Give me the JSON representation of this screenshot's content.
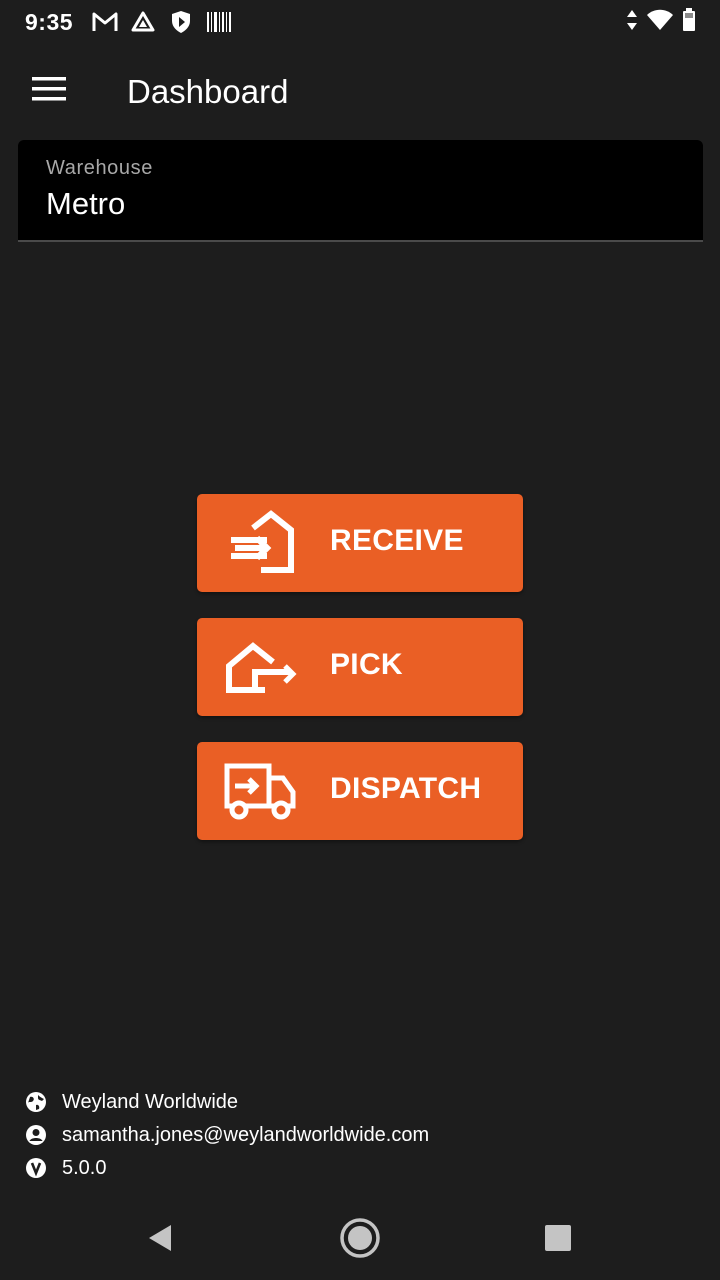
{
  "status_bar": {
    "time": "9:35",
    "left_icons": [
      "gmail-icon",
      "drive-icon",
      "shield-play-icon",
      "barcode-icon"
    ],
    "right_icons": [
      "data-arrows-icon",
      "wifi-icon",
      "battery-icon"
    ]
  },
  "app_bar": {
    "title": "Dashboard",
    "menu_icon": "hamburger-menu-icon"
  },
  "warehouse": {
    "label": "Warehouse",
    "value": "Metro"
  },
  "actions": {
    "receive": {
      "label": "RECEIVE",
      "icon": "receive-house-icon"
    },
    "pick": {
      "label": "PICK",
      "icon": "pick-house-icon"
    },
    "dispatch": {
      "label": "DISPATCH",
      "icon": "dispatch-truck-icon"
    }
  },
  "footer": {
    "company": "Weyland Worldwide",
    "email": "samantha.jones@weylandworldwide.com",
    "version": "5.0.0"
  },
  "colors": {
    "background": "#1d1d1d",
    "accent": "#ea5f25",
    "field_background": "#000000"
  }
}
